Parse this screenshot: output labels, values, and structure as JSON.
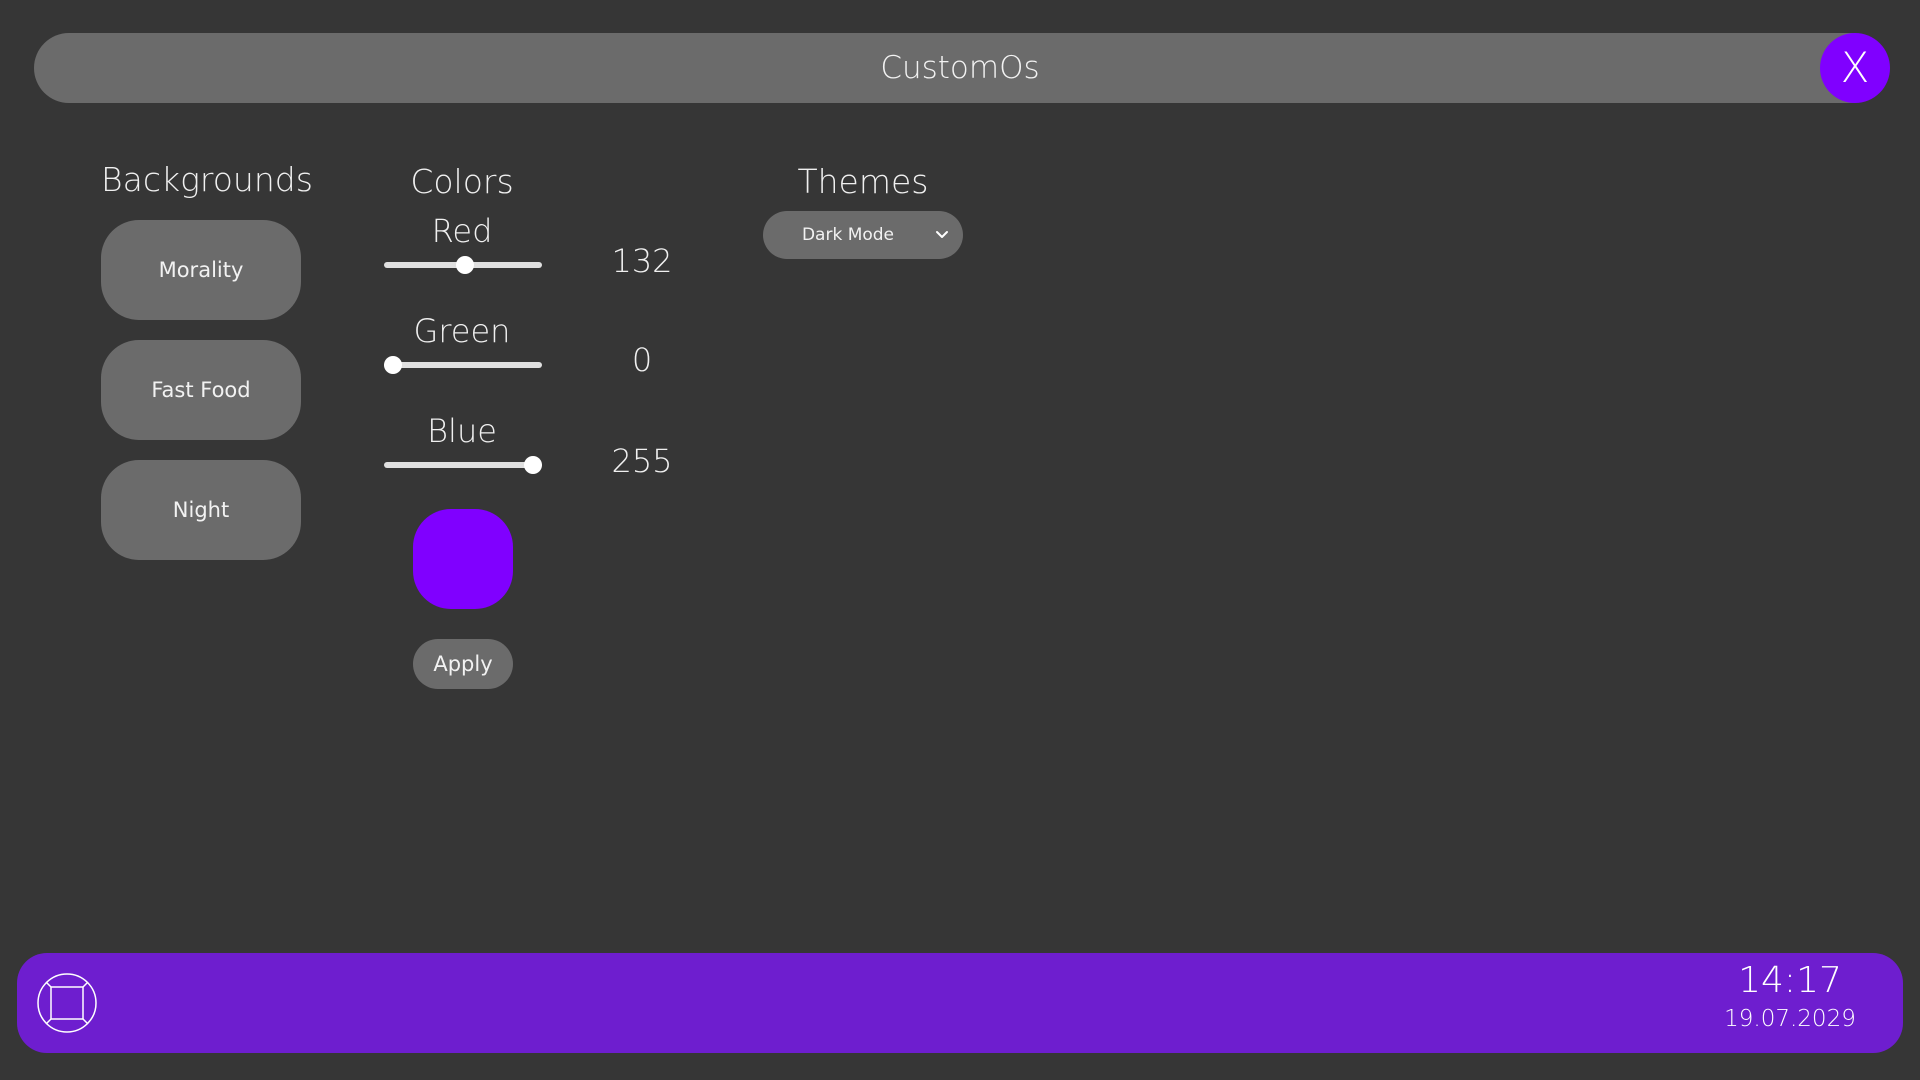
{
  "window": {
    "title": "CustomOs",
    "close_label": "X"
  },
  "accent_color": "#8000ff",
  "taskbar_color": "#6e1ecf",
  "backgrounds": {
    "heading": "Backgrounds",
    "items": [
      {
        "label": "Morality"
      },
      {
        "label": "Fast Food"
      },
      {
        "label": "Night"
      }
    ]
  },
  "colors": {
    "heading": "Colors",
    "sliders": [
      {
        "label": "Red",
        "value": "132",
        "max": 255
      },
      {
        "label": "Green",
        "value": "0",
        "max": 255
      },
      {
        "label": "Blue",
        "value": "255",
        "max": 255
      }
    ],
    "preview_color": "#8000ff",
    "apply_label": "Apply"
  },
  "themes": {
    "heading": "Themes",
    "selected": "Dark Mode",
    "icon": "chevron-down-icon"
  },
  "taskbar": {
    "start_icon": "start-menu-icon",
    "time": "14:17",
    "date": "19.07.2029"
  }
}
